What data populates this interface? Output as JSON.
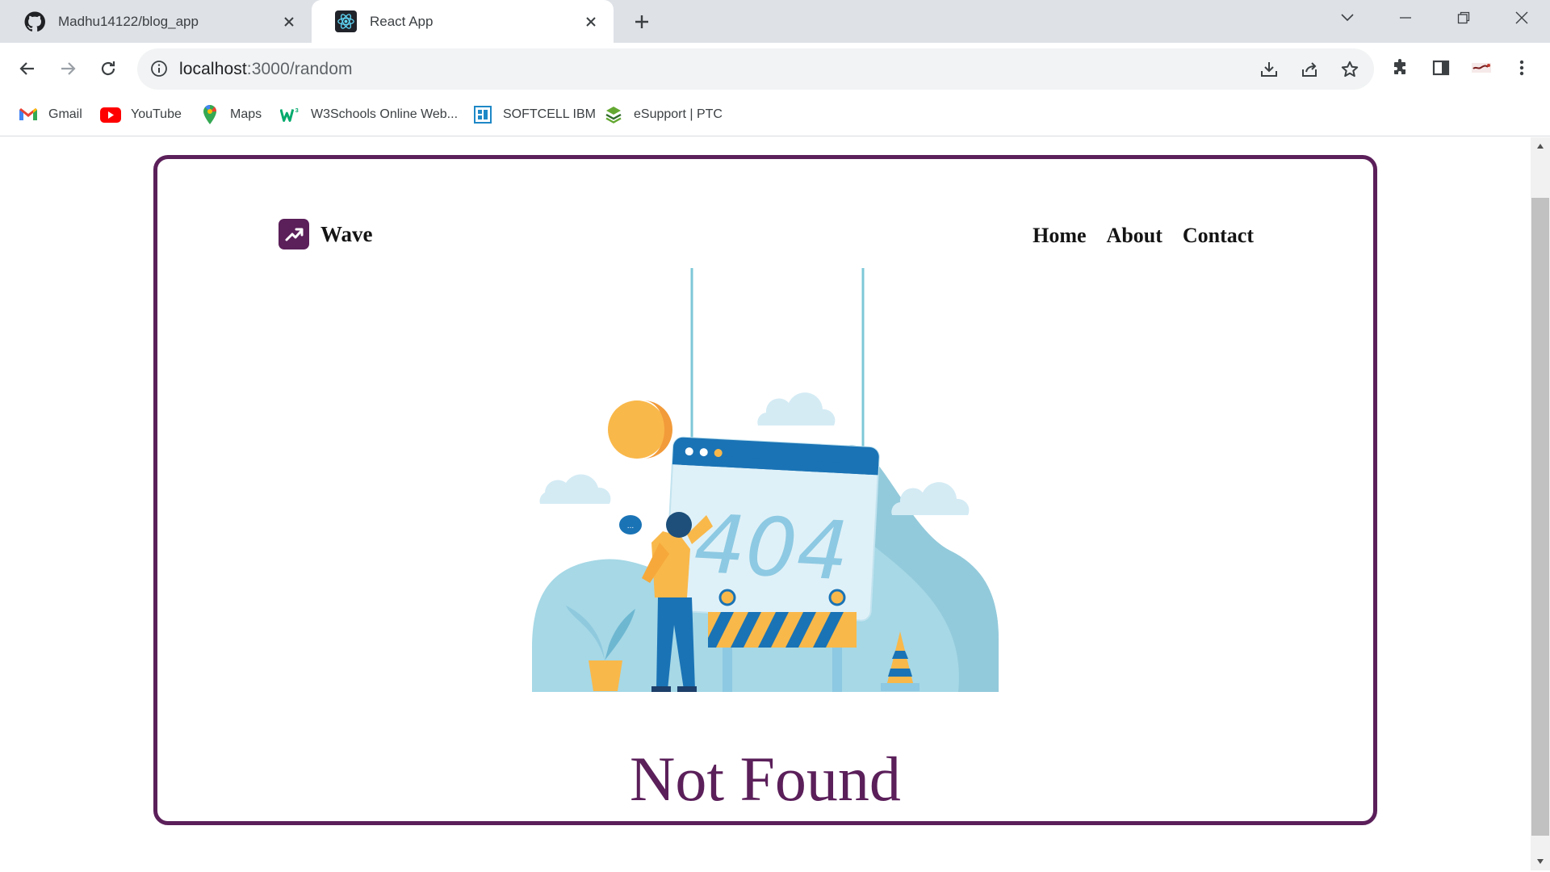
{
  "browser": {
    "tabs": [
      {
        "title": "Madhu14122/blog_app",
        "icon": "github-icon",
        "active": false
      },
      {
        "title": "React App",
        "icon": "react-icon",
        "active": true
      }
    ],
    "address": {
      "url_host": "localhost",
      "url_path": ":3000/random"
    },
    "bookmarks": [
      {
        "label": "Gmail",
        "icon": "gmail-icon"
      },
      {
        "label": "YouTube",
        "icon": "youtube-icon"
      },
      {
        "label": "Maps",
        "icon": "maps-icon"
      },
      {
        "label": "W3Schools Online Web...",
        "icon": "w3schools-icon"
      },
      {
        "label": "SOFTCELL IBM",
        "icon": "softcell-icon"
      },
      {
        "label": "eSupport | PTC",
        "icon": "ptc-icon"
      }
    ]
  },
  "page": {
    "brand": "Wave",
    "nav": [
      "Home",
      "About",
      "Contact"
    ],
    "illustration_text": "404",
    "speech_bubble": "...",
    "heading": "Not Found",
    "colors": {
      "accent": "#5b1f5a",
      "illustration_blue": "#a6d8e6",
      "illustration_dark_blue": "#1a73b5",
      "illustration_orange": "#f9b84a"
    }
  }
}
